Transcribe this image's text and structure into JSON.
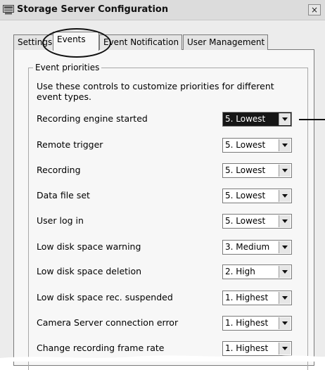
{
  "window": {
    "title": "Storage Server Configuration",
    "close_label": "×"
  },
  "tabs": [
    {
      "label": "Settings",
      "active": false
    },
    {
      "label": "Events",
      "active": true
    },
    {
      "label": "Event Notification",
      "active": false
    },
    {
      "label": "User Management",
      "active": false
    }
  ],
  "event_priorities": {
    "group_title": "Event priorities",
    "description": "Use these controls to customize priorities for different event types.",
    "rows": [
      {
        "label": "Recording engine started",
        "value": "5. Lowest",
        "focused": true
      },
      {
        "label": "Remote trigger",
        "value": "5. Lowest"
      },
      {
        "label": "Recording",
        "value": "5. Lowest"
      },
      {
        "label": "Data file set",
        "value": "5. Lowest"
      },
      {
        "label": "User log in",
        "value": "5. Lowest"
      },
      {
        "label": "Low disk space warning",
        "value": "3. Medium"
      },
      {
        "label": "Low disk space deletion",
        "value": "2. High"
      },
      {
        "label": "Low disk space rec. suspended",
        "value": "1. Highest"
      },
      {
        "label": "Camera Server connection error",
        "value": "1. Highest"
      },
      {
        "label": "Change recording frame rate",
        "value": "1. Highest"
      }
    ]
  },
  "colors": {
    "focused_select_bg": "#161616",
    "panel_bg": "#f7f7f7"
  }
}
